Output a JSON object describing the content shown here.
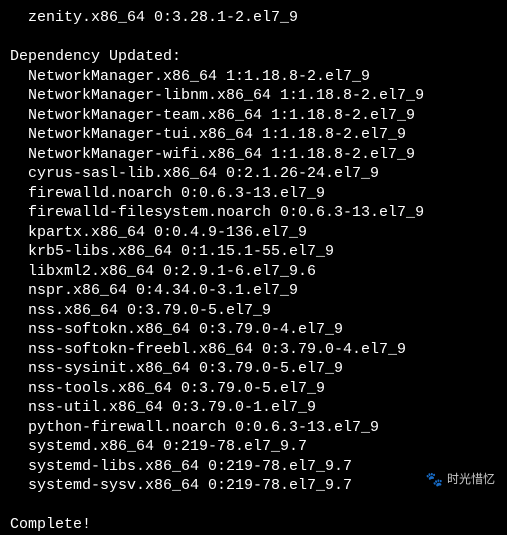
{
  "top_line": "zenity.x86_64 0:3.28.1-2.el7_9",
  "section_header": "Dependency Updated:",
  "packages": [
    "NetworkManager.x86_64 1:1.18.8-2.el7_9",
    "NetworkManager-libnm.x86_64 1:1.18.8-2.el7_9",
    "NetworkManager-team.x86_64 1:1.18.8-2.el7_9",
    "NetworkManager-tui.x86_64 1:1.18.8-2.el7_9",
    "NetworkManager-wifi.x86_64 1:1.18.8-2.el7_9",
    "cyrus-sasl-lib.x86_64 0:2.1.26-24.el7_9",
    "firewalld.noarch 0:0.6.3-13.el7_9",
    "firewalld-filesystem.noarch 0:0.6.3-13.el7_9",
    "kpartx.x86_64 0:0.4.9-136.el7_9",
    "krb5-libs.x86_64 0:1.15.1-55.el7_9",
    "libxml2.x86_64 0:2.9.1-6.el7_9.6",
    "nspr.x86_64 0:4.34.0-3.1.el7_9",
    "nss.x86_64 0:3.79.0-5.el7_9",
    "nss-softokn.x86_64 0:3.79.0-4.el7_9",
    "nss-softokn-freebl.x86_64 0:3.79.0-4.el7_9",
    "nss-sysinit.x86_64 0:3.79.0-5.el7_9",
    "nss-tools.x86_64 0:3.79.0-5.el7_9",
    "nss-util.x86_64 0:3.79.0-1.el7_9",
    "python-firewall.noarch 0:0.6.3-13.el7_9",
    "systemd.x86_64 0:219-78.el7_9.7",
    "systemd-libs.x86_64 0:219-78.el7_9.7",
    "systemd-sysv.x86_64 0:219-78.el7_9.7"
  ],
  "complete": "Complete!",
  "watermark": "时光惜忆"
}
